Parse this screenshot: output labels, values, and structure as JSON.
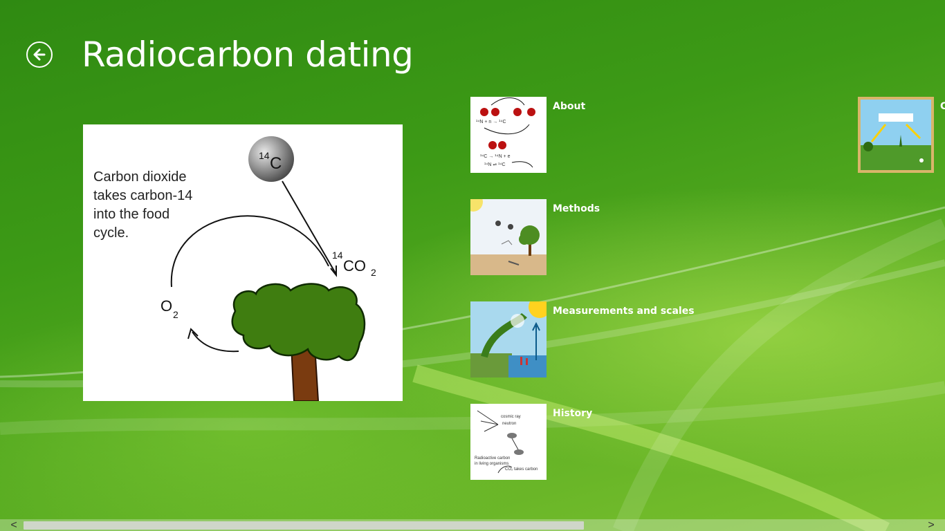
{
  "header": {
    "title": "Radiocarbon dating",
    "back_icon": "back-arrow-icon"
  },
  "hero": {
    "caption_lines": [
      "Carbon dioxide",
      "takes carbon-14",
      "into the food",
      "cycle."
    ],
    "c14_mass": "14",
    "c14_symbol": "C",
    "co2_mass": "14",
    "co2_symbol": "CO",
    "co2_sub": "2",
    "o2_symbol": "O",
    "o2_sub": "2"
  },
  "sections": [
    {
      "label": "About",
      "thumb": "about-thumbnail"
    },
    {
      "label": "Methods",
      "thumb": "methods-thumbnail"
    },
    {
      "label": "Measurements and scales",
      "thumb": "measurements-thumbnail"
    },
    {
      "label": "History",
      "thumb": "history-thumbnail"
    },
    {
      "label": "C",
      "thumb": "carbon-cycle-thumbnail"
    }
  ],
  "scrollbar": {
    "left_arrow": "<",
    "right_arrow": ">"
  }
}
